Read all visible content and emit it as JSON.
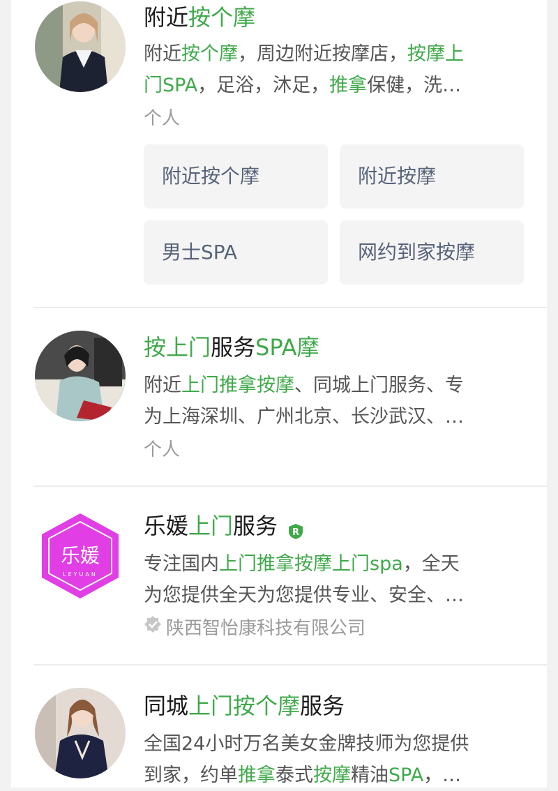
{
  "results": [
    {
      "title_parts": [
        {
          "t": "附近",
          "h": false
        },
        {
          "t": "按个摩",
          "h": true
        }
      ],
      "desc_lines": [
        [
          {
            "t": "附近",
            "h": false
          },
          {
            "t": "按个摩",
            "h": true
          },
          {
            "t": "，周边附近按摩店，",
            "h": false
          },
          {
            "t": "按摩上",
            "h": true
          }
        ],
        [
          {
            "t": "门SPA",
            "h": true
          },
          {
            "t": "，足浴，沐足，",
            "h": false
          },
          {
            "t": "推拿",
            "h": true
          },
          {
            "t": "保健，洗…",
            "h": false
          }
        ]
      ],
      "type": "个人",
      "chips": [
        "附近按个摩",
        "附近按摩",
        "男士SPA",
        "网约到家按摩"
      ]
    },
    {
      "title_parts": [
        {
          "t": "按上门",
          "h": true
        },
        {
          "t": "服务",
          "h": false
        },
        {
          "t": "SPA摩",
          "h": true
        }
      ],
      "desc_lines": [
        [
          {
            "t": "附近",
            "h": false
          },
          {
            "t": "上门推拿按摩",
            "h": true
          },
          {
            "t": "、同城上门服务、专",
            "h": false
          }
        ],
        [
          {
            "t": "为上海深圳、广州北京、长沙武汉、…",
            "h": false
          }
        ]
      ],
      "type": "个人"
    },
    {
      "title_parts": [
        {
          "t": "乐媛",
          "h": false
        },
        {
          "t": "上门",
          "h": true
        },
        {
          "t": "服务",
          "h": false
        }
      ],
      "logo_text": "乐媛",
      "logo_sub": "LEYUAN",
      "desc_lines": [
        [
          {
            "t": "专注国内",
            "h": false
          },
          {
            "t": "上门推拿按摩上门spa",
            "h": true
          },
          {
            "t": "，全天",
            "h": false
          }
        ],
        [
          {
            "t": "为您提供全天为您提供专业、安全、…",
            "h": false
          }
        ]
      ],
      "company": "陕西智怡康科技有限公司"
    },
    {
      "title_parts": [
        {
          "t": "同城",
          "h": false
        },
        {
          "t": "上门按个摩",
          "h": true
        },
        {
          "t": "服务",
          "h": false
        }
      ],
      "desc_lines": [
        [
          {
            "t": "全国24小时万名美女金牌技师为您提供",
            "h": false
          }
        ],
        [
          {
            "t": "到家，约单",
            "h": false
          },
          {
            "t": "推拿",
            "h": true
          },
          {
            "t": "泰式",
            "h": false
          },
          {
            "t": "按摩",
            "h": true
          },
          {
            "t": "精油",
            "h": false
          },
          {
            "t": "SPA",
            "h": true
          },
          {
            "t": "，…",
            "h": false
          }
        ]
      ]
    }
  ],
  "colors": {
    "highlight": "#3fa94a",
    "text": "#1a1a1a",
    "secondary": "#9a9a9a",
    "logo_magenta": "#e23ee6"
  }
}
